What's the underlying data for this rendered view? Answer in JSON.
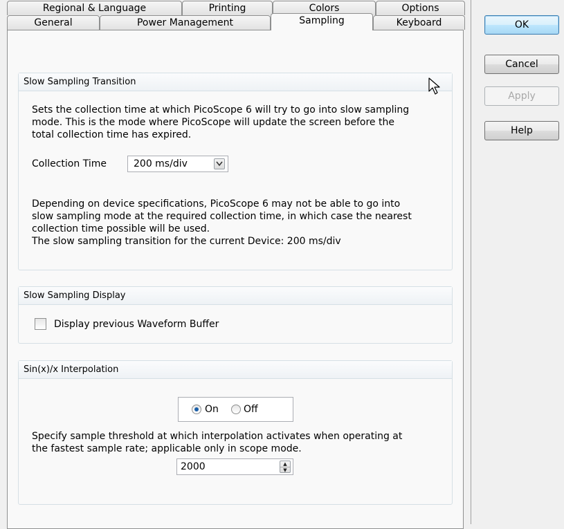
{
  "tabs": {
    "row1": [
      "Regional & Language",
      "Printing",
      "Colors",
      "Options"
    ],
    "row2": [
      "General",
      "Power Management",
      "Sampling",
      "Keyboard"
    ],
    "active": "Sampling"
  },
  "buttons": {
    "ok": "OK",
    "cancel": "Cancel",
    "apply": "Apply",
    "help": "Help"
  },
  "slow_sampling_transition": {
    "title": "Slow Sampling Transition",
    "desc": [
      "Sets the collection time at which PicoScope 6 will try to go into slow sampling",
      "mode. This is the mode where PicoScope will update the screen before the",
      "total collection time has expired."
    ],
    "collection_time_label": "Collection Time",
    "collection_time_value": "200 ms/div",
    "note": [
      "Depending on device specifications, PicoScope 6 may not be able to go into",
      "slow sampling mode at the required collection time, in which case the nearest",
      "collection time possible will be used.",
      "The slow sampling transition for the current Device: 200 ms/div"
    ]
  },
  "slow_sampling_display": {
    "title": "Slow Sampling Display",
    "checkbox_label": "Display previous Waveform Buffer",
    "checked": false
  },
  "interpolation": {
    "title": "Sin(x)/x Interpolation",
    "on_label": "On",
    "off_label": "Off",
    "selected": "On",
    "desc": [
      "Specify sample threshold at which interpolation activates when operating at",
      "the fastest sample rate; applicable only in scope mode."
    ],
    "threshold": "2000"
  },
  "icons": {
    "dropdown": "chevron-down-icon",
    "spin_up": "spin-up-icon",
    "spin_down": "spin-down-icon",
    "cursor": "mouse-pointer-icon"
  }
}
